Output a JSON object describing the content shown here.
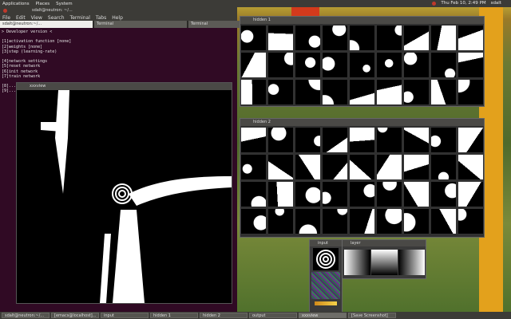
{
  "top_panel": {
    "menus": [
      "Applications",
      "Places",
      "System"
    ],
    "datetime": "Thu Feb 10, 2:49 PM",
    "user": "sdalt"
  },
  "terminal": {
    "title": "sdalt@neutron: ~/...",
    "menu": [
      "File",
      "Edit",
      "View",
      "Search",
      "Terminal",
      "Tabs",
      "Help"
    ],
    "tabs": [
      "sdalt@neutron:~/...",
      "Terminal",
      "Terminal"
    ],
    "lines": [
      "> Developer version <",
      "",
      "[1]activation function [none]",
      "[2]weights [none]",
      "[3]step (learning-rate)",
      "",
      "[4]network settings",
      "[5]reset network",
      "[6]init network",
      "[7]train network",
      "",
      "[8]...",
      "[9]..."
    ]
  },
  "xview": {
    "title": "xxxview"
  },
  "hidden1": {
    "title": "hidden 1"
  },
  "hidden2": {
    "title": "hidden 2"
  },
  "input_win": {
    "title": "input"
  },
  "layer_win": {
    "title": "layer"
  },
  "taskbar": {
    "items": [
      "sdalt@neutron:~/...",
      "[emacs@localhost]...",
      "input",
      "hidden 1",
      "hidden 2",
      "output",
      "xxxview",
      "[Save Screenshot]"
    ]
  },
  "colors": {
    "terminal_bg": "#300a24",
    "panel": "#3c3b37",
    "accent": "#e3a11c"
  }
}
